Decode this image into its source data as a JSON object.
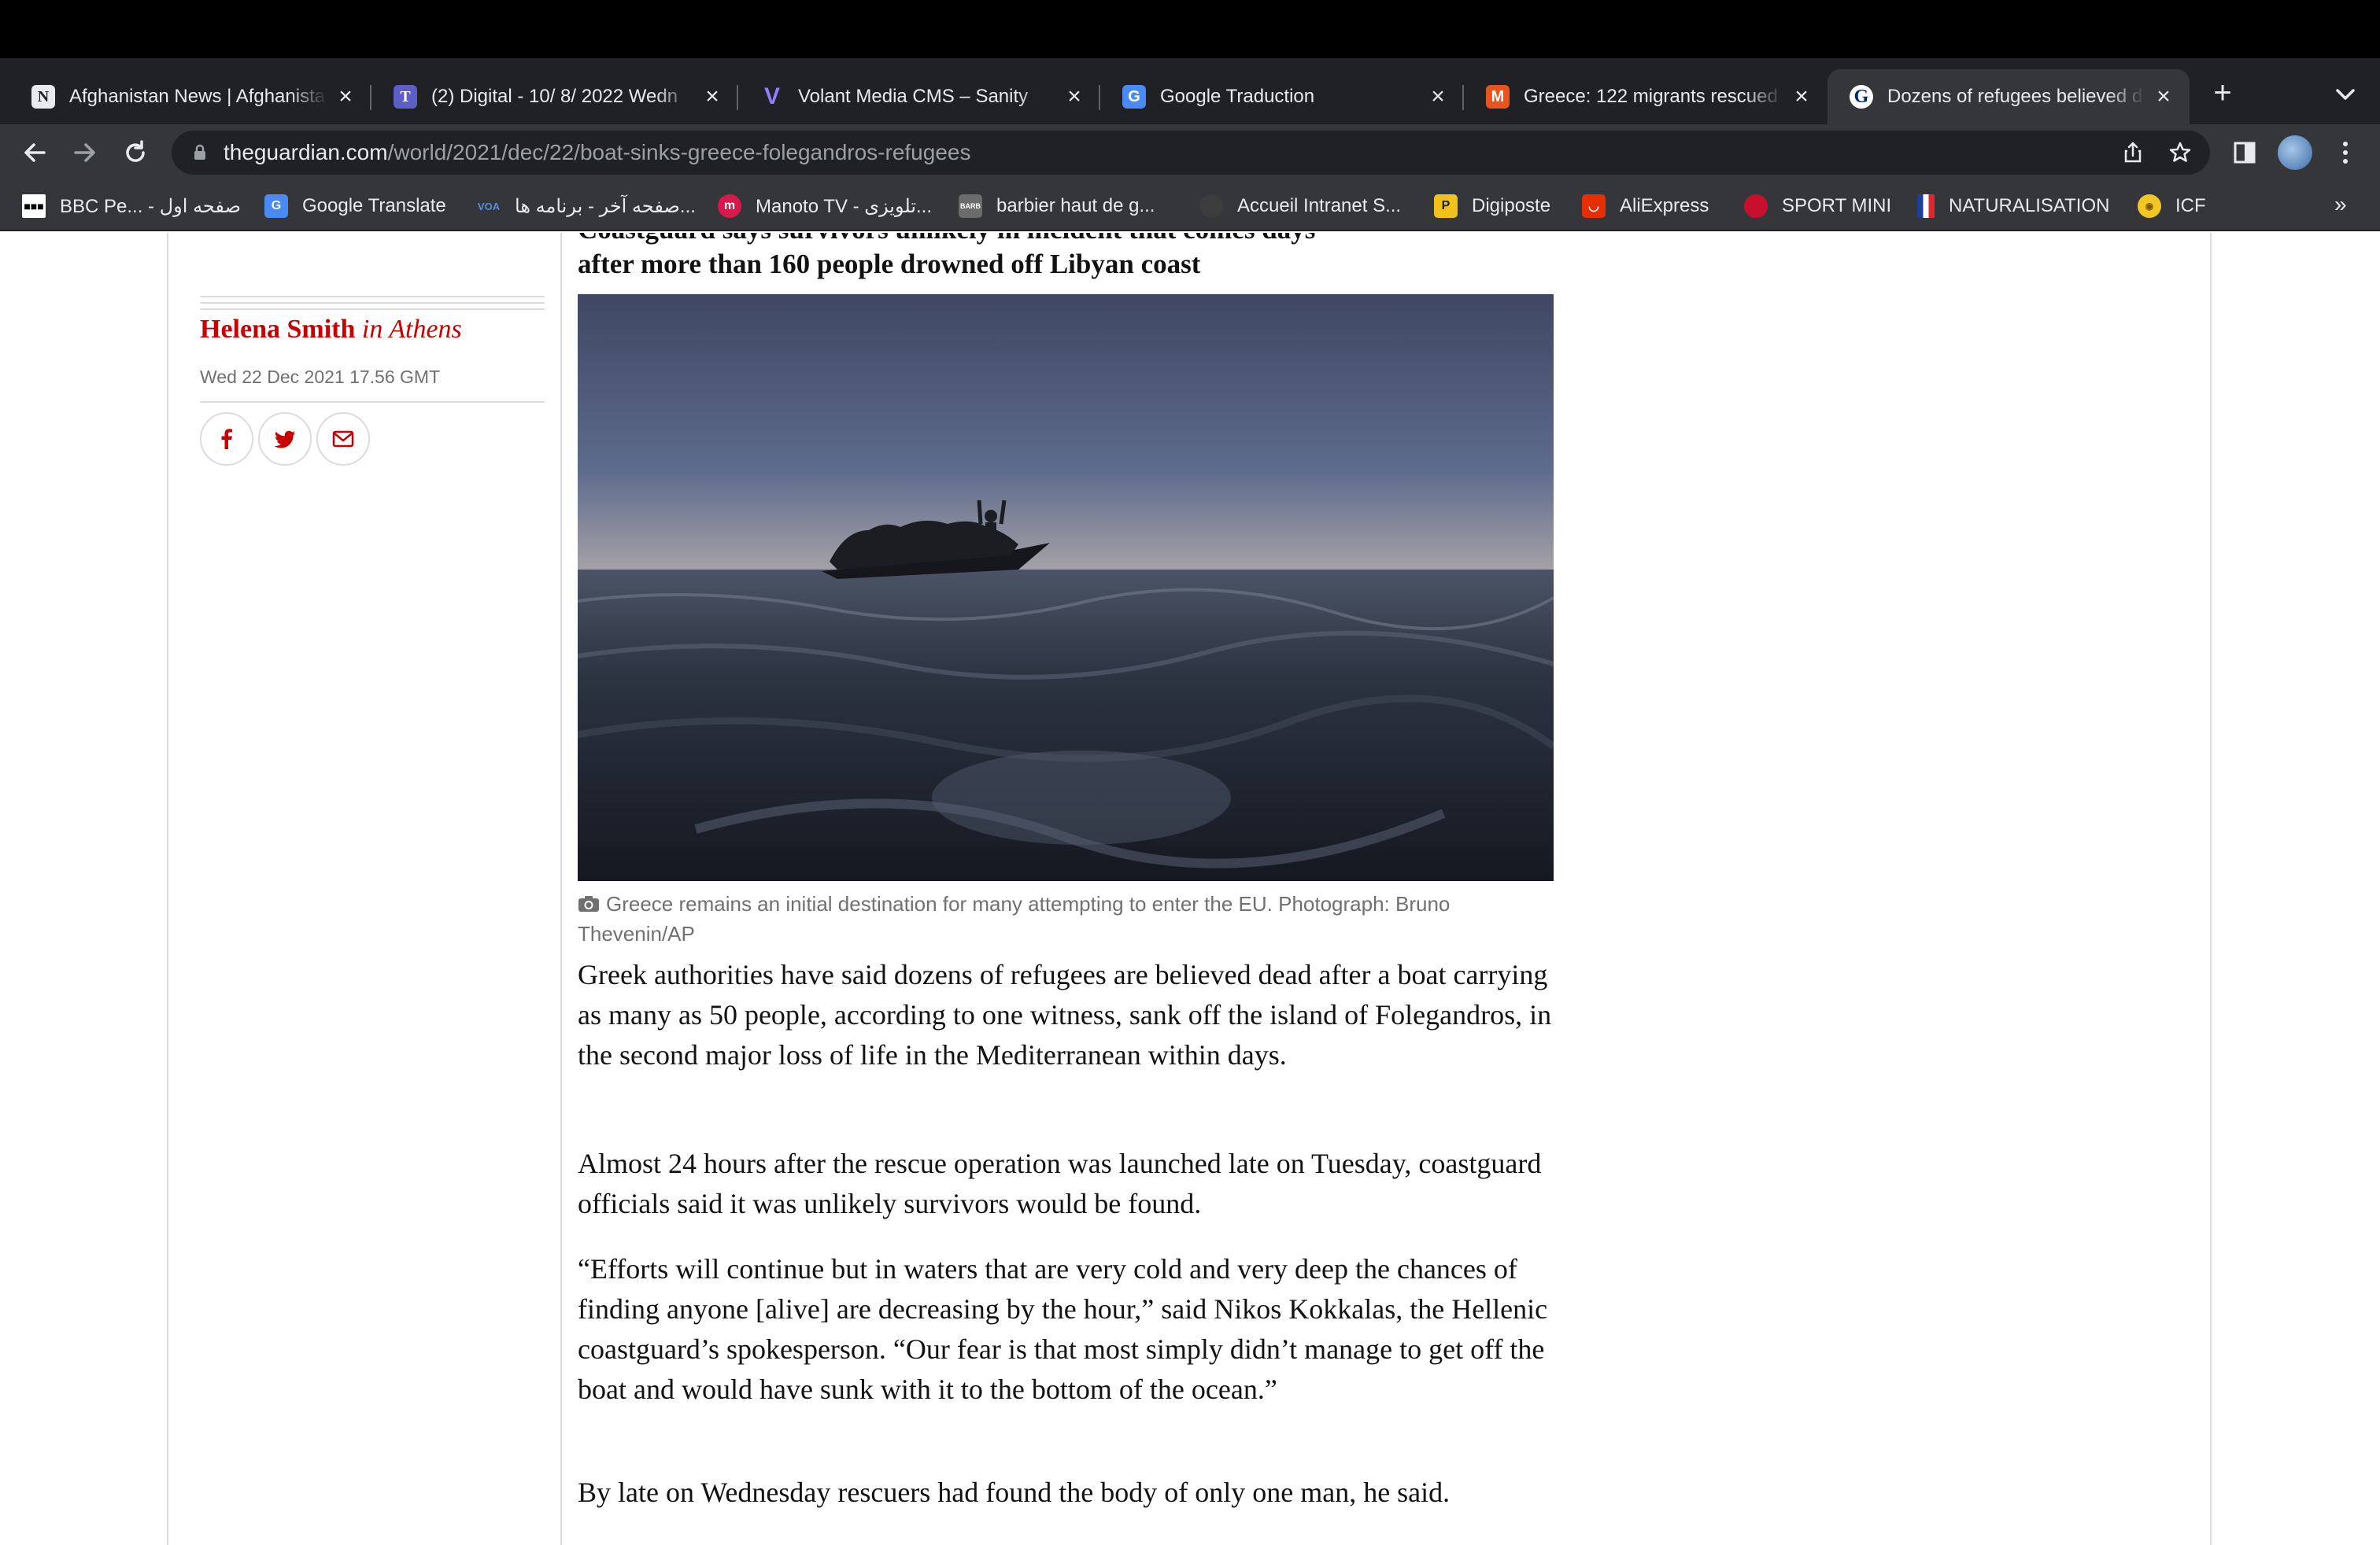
{
  "browser": {
    "tabs": [
      {
        "title": "Afghanistan News | Afghanistan",
        "favicon_letter": "N",
        "favicon_color": "#e8eaed"
      },
      {
        "title": "(2) Digital - 10/ 8/ 2022 Wedn",
        "favicon_letter": "T",
        "favicon_color": "#5b5fc7"
      },
      {
        "title": "Volant Media CMS – Sanity",
        "favicon_letter": "V",
        "favicon_color": "#6a5cff"
      },
      {
        "title": "Google Traduction",
        "favicon_letter": "G",
        "favicon_color": "#4a8af4"
      },
      {
        "title": "Greece: 122 migrants rescued",
        "favicon_letter": "M",
        "favicon_color": "#e8541e"
      },
      {
        "title": "Dozens of refugees believed d",
        "favicon_letter": "G",
        "favicon_color": "#052962"
      }
    ],
    "active_tab": 5,
    "url_host": "theguardian.com",
    "url_path": "/world/2021/dec/22/boat-sinks-greece-folegandros-refugees",
    "bookmarks": [
      {
        "label": "BBC Pe... - صفحه اول",
        "color": "#ffffff"
      },
      {
        "label": "Google Translate",
        "color": "#4a8af4"
      },
      {
        "label": "صفحه آخر - برنامه ها...",
        "color": "#1f5bb5"
      },
      {
        "label": "Manoto TV - تلویزی...",
        "color": "#d7194b"
      },
      {
        "label": "barbier haut de g...",
        "color": "#6b6b6b"
      },
      {
        "label": "Accueil Intranet S...",
        "color": "#4c4c4c"
      },
      {
        "label": "Digiposte",
        "color": "#f2c21b"
      },
      {
        "label": "AliExpress",
        "color": "#e62e04"
      },
      {
        "label": "SPORT MINI",
        "color": "#c8102e"
      },
      {
        "label": "NATURALISATION",
        "color": "#ffffff"
      },
      {
        "label": "ICF",
        "color": "#f3c623"
      }
    ]
  },
  "article": {
    "headline_cut": "Coastguard says survivors unlikely in incident that comes days",
    "headline_tail": "after more than 160 people drowned off Libyan coast",
    "author_name": "Helena Smith",
    "author_location": "in Athens",
    "dateline": "Wed 22 Dec 2021 17.56 GMT",
    "share_icons": [
      "facebook-icon",
      "twitter-icon",
      "email-icon"
    ],
    "caption": "Greece remains an initial destination for many attempting to enter the EU. Photograph: Bruno Thevenin/AP",
    "paragraphs": [
      "Greek authorities have said dozens of refugees are believed dead after a boat carrying as many as 50 people, according to one witness, sank off the island of Folegandros, in the second major loss of life in the Mediterranean within days.",
      "Almost 24 hours after the rescue operation was launched late on Tuesday, coastguard officials said it was unlikely survivors would be found.",
      "“Efforts will continue but in waters that are very cold and very deep the chances of finding anyone [alive] are decreasing by the hour,” said Nikos Kokkalas, the Hellenic coastguard’s spokesperson. “Our fear is that most simply didn’t manage to get off the boat and would have sunk with it to the bottom of the ocean.”",
      "By late on Wednesday rescuers had found the body of only one man, he said."
    ]
  },
  "colors": {
    "guardian_red": "#c70000",
    "chrome_dark": "#202124",
    "chrome_toolbar": "#35363a"
  }
}
